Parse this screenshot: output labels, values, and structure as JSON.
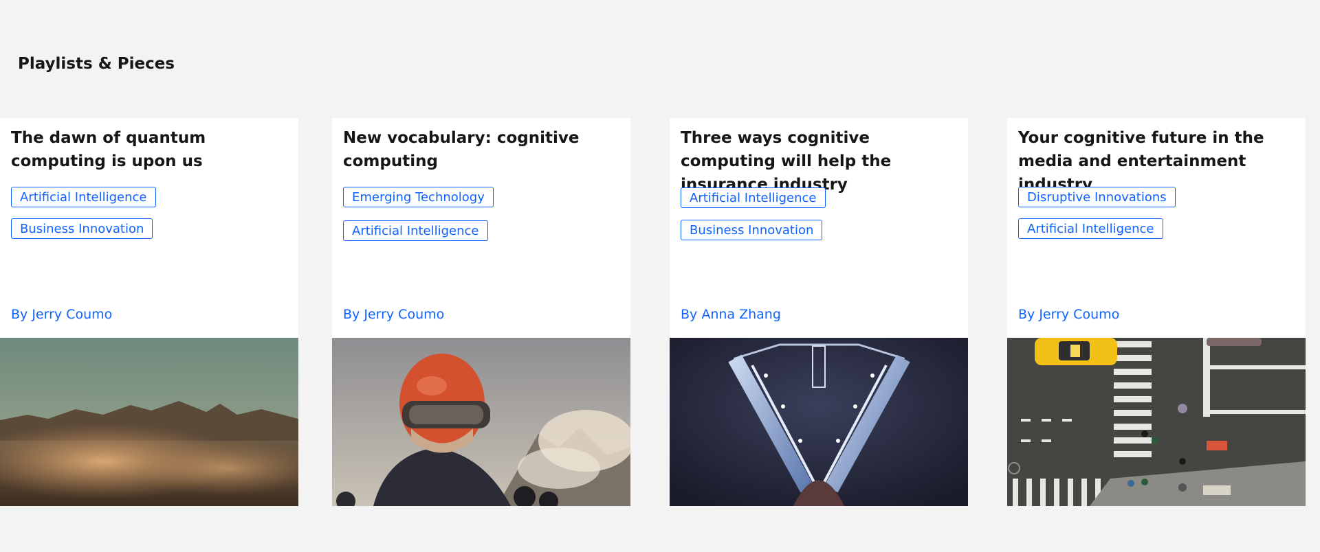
{
  "section": {
    "title": "Playlists & Pieces"
  },
  "cards": [
    {
      "title": "The dawn of quantum computing is upon us",
      "tags": [
        "Artificial Intelligence",
        "Business Innovation"
      ],
      "author": "By Jerry Coumo",
      "image": "mountain-landscape-photo"
    },
    {
      "title": "New vocabulary: cognitive computing",
      "tags": [
        "Emerging Technology",
        "Artificial Intelligence"
      ],
      "author": "By Jerry Coumo",
      "image": "helmet-person-photo"
    },
    {
      "title": "Three ways cognitive computing will help the insurance industry",
      "tags": [
        "Artificial Intelligence",
        "Business Innovation"
      ],
      "author": "By Anna Zhang",
      "image": "triangle-structure-photo"
    },
    {
      "title": "Your cognitive future in the media and entertainment industry",
      "tags": [
        "Disruptive Innovations",
        "Artificial Intelligence"
      ],
      "author": "By Jerry Coumo",
      "image": "street-crosswalk-photo"
    }
  ]
}
